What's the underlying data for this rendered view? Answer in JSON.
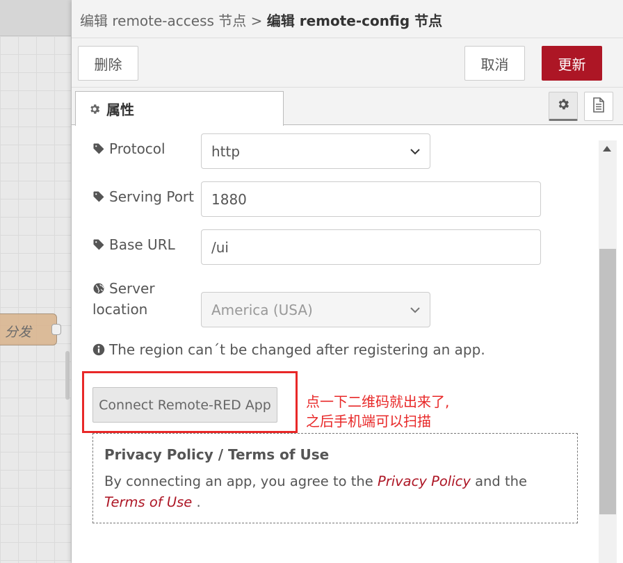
{
  "workspace": {
    "node_label": "分发"
  },
  "header": {
    "parent_crumb": "编辑 remote-access 节点",
    "separator": ">",
    "current_crumb": "编辑 remote-config 节点"
  },
  "toolbar": {
    "delete_label": "删除",
    "cancel_label": "取消",
    "update_label": "更新",
    "update_color": "#ad1625"
  },
  "tabs": {
    "properties_label": "属性",
    "settings_icon": "gear-icon",
    "info_icon": "document-icon"
  },
  "form": {
    "protocol": {
      "label": "Protocol",
      "icon": "tag-icon",
      "value": "http"
    },
    "port": {
      "label": "Serving Port",
      "icon": "tag-icon",
      "value": "1880"
    },
    "base_url": {
      "label": "Base URL",
      "icon": "tag-icon",
      "value": "/ui"
    },
    "server_location": {
      "label_line1": "Server",
      "label_line2": "location",
      "icon": "globe-icon",
      "value": "America (USA)"
    },
    "region_note": "The region can´t be changed after registering an app.",
    "connect_button": "Connect Remote-RED App"
  },
  "annotation": {
    "line1": "点一下二维码就出来了,",
    "line2": "之后手机端可以扫描",
    "color": "#e82828"
  },
  "privacy": {
    "title": "Privacy Policy / Terms of Use",
    "text_before": "By connecting an app, you agree to the ",
    "privacy_link": "Privacy Policy",
    "text_middle": " and the ",
    "terms_link": "Terms of Use",
    "text_after": " ."
  }
}
